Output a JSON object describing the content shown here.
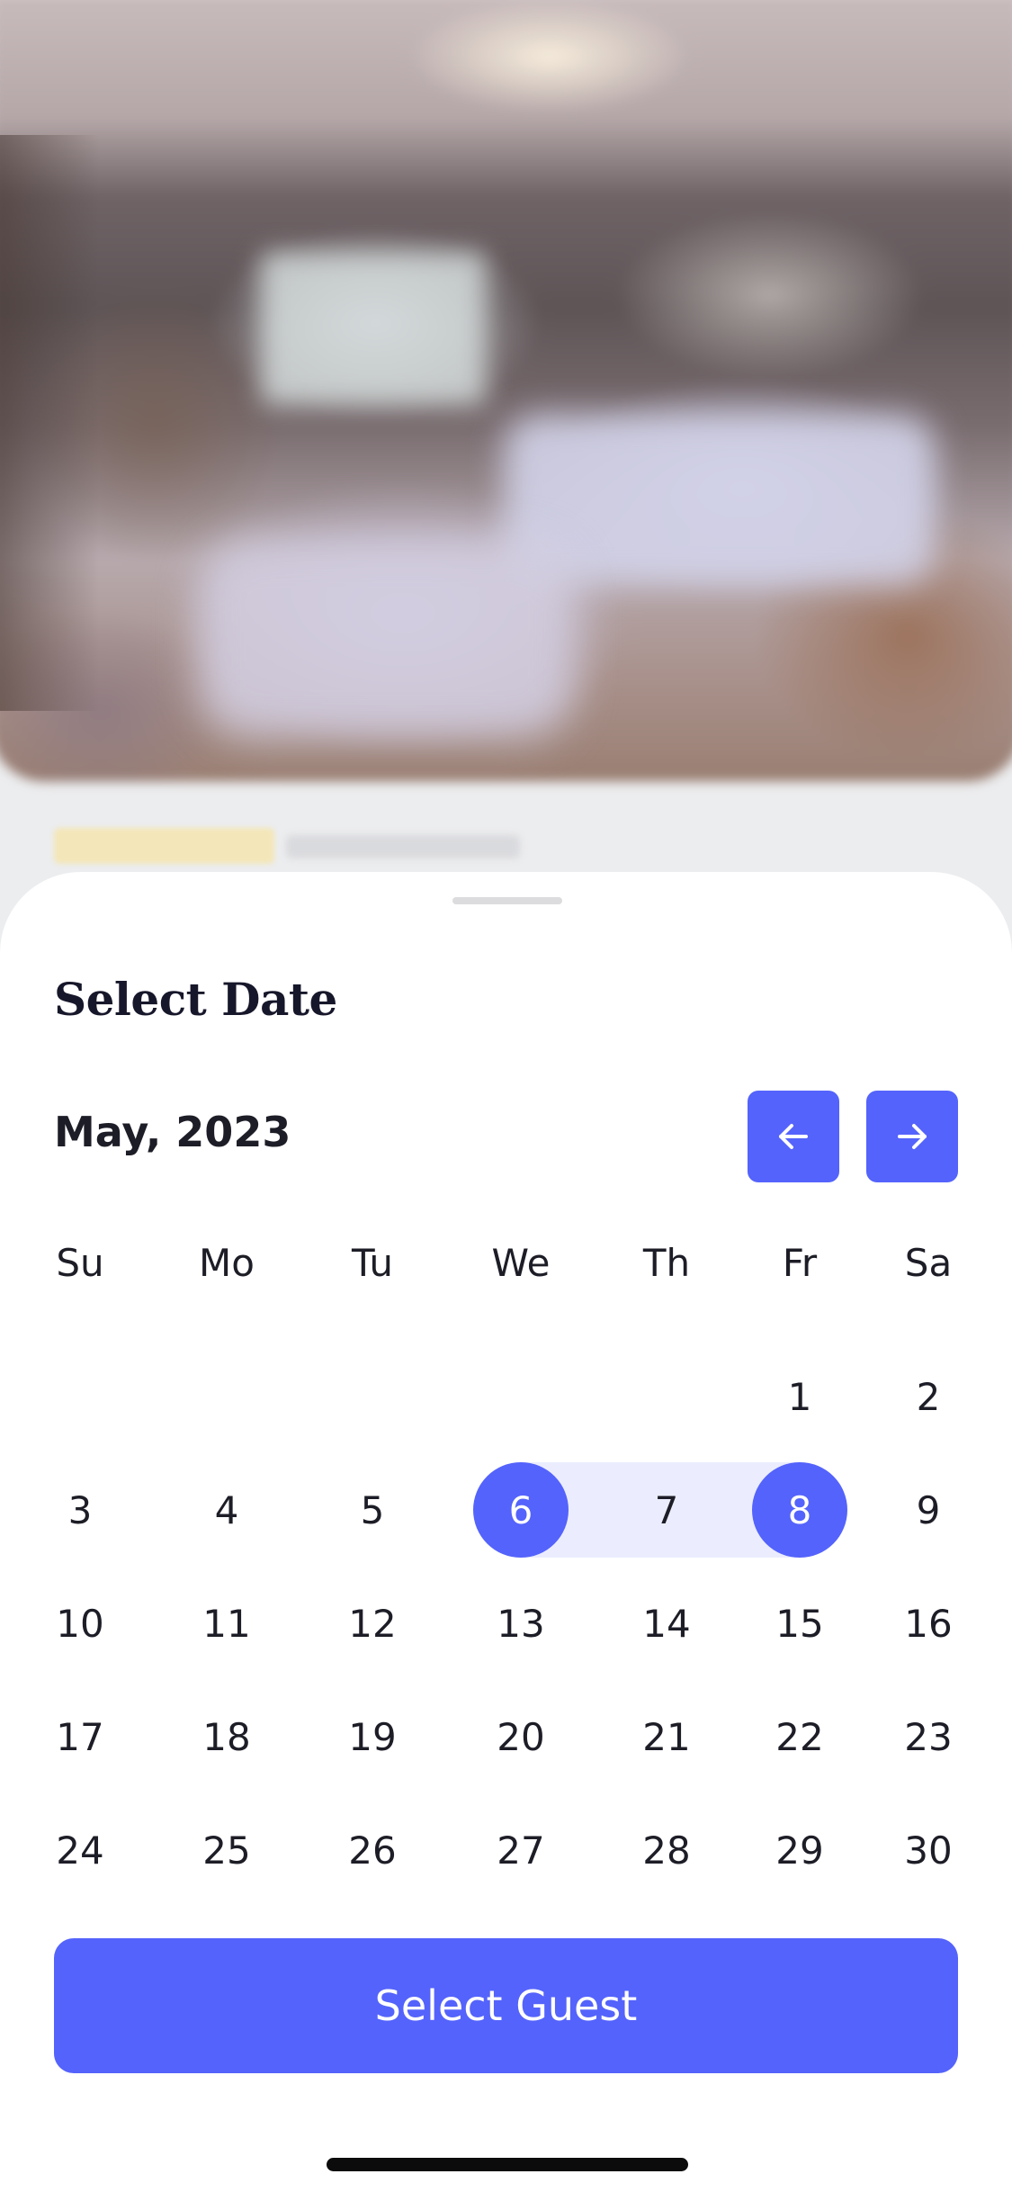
{
  "sheet": {
    "title": "Select Date"
  },
  "calendar": {
    "month_label": "May, 2023",
    "prev_icon": "arrow-left-icon",
    "next_icon": "arrow-right-icon",
    "weekdays": [
      "Su",
      "Mo",
      "Tu",
      "We",
      "Th",
      "Fr",
      "Sa"
    ],
    "first_weekday_index": 5,
    "days_in_month": 30,
    "selected_start": 6,
    "selected_end": 8
  },
  "actions": {
    "select_guest_label": "Select Guest"
  },
  "colors": {
    "accent": "#5463fb",
    "range_fill": "#ebedfe",
    "text": "#1d1d27",
    "sheet_bg": "#ffffff"
  }
}
